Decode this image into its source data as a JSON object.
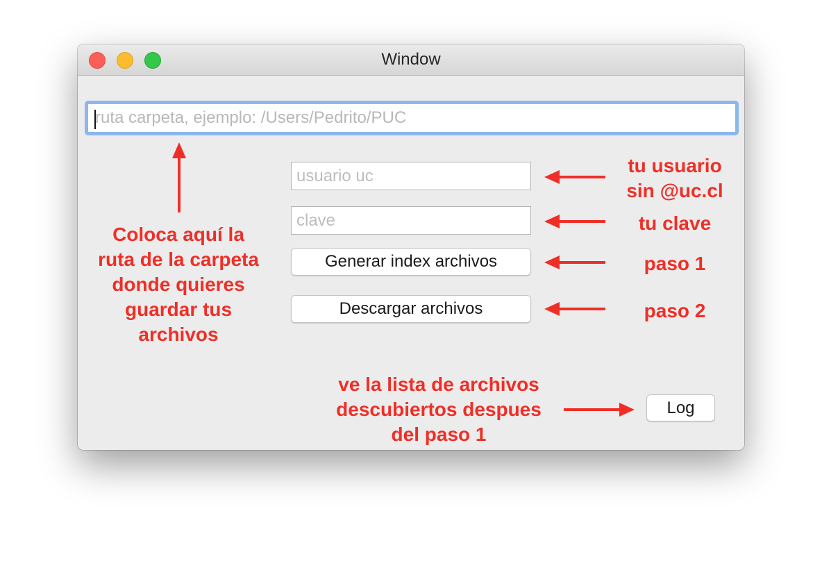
{
  "window": {
    "title": "Window"
  },
  "form": {
    "path_placeholder": "ruta carpeta, ejemplo: /Users/Pedrito/PUC",
    "user_placeholder": "usuario uc",
    "password_placeholder": "clave",
    "generate_label": "Generar index archivos",
    "download_label": "Descargar archivos",
    "log_label": "Log"
  },
  "annotations": {
    "color": "#ef2f27",
    "user_line1": "tu usuario",
    "user_line2": "sin @uc.cl",
    "password": "tu clave",
    "step1": "paso 1",
    "step2": "paso 2",
    "folder_line1": "Coloca aquí la",
    "folder_line2": "ruta de la carpeta",
    "folder_line3": "donde quieres",
    "folder_line4": "guardar tus",
    "folder_line5": "archivos",
    "log_line1": "ve la lista de archivos",
    "log_line2": "descubiertos despues",
    "log_line3": "del paso 1"
  },
  "colors": {
    "focus_ring": "#8cb7ec",
    "traffic_close": "#fc5f57",
    "traffic_minimize": "#fdbc2e",
    "traffic_zoom": "#34c84a"
  }
}
